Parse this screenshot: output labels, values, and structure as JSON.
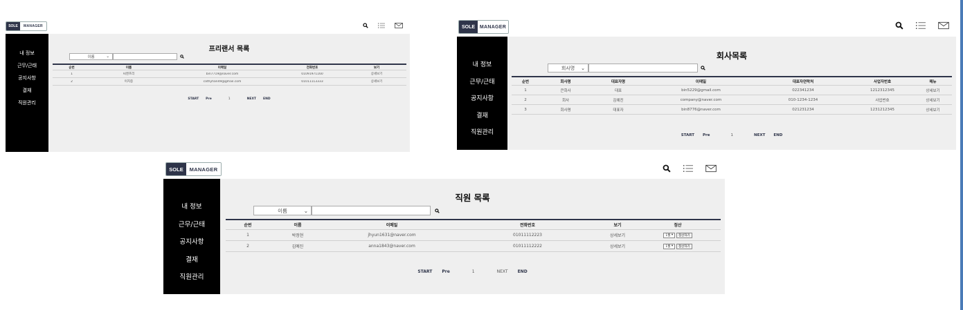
{
  "app": {
    "logo_left": "SOLE",
    "logo_right": "MANAGER"
  },
  "sidebar": {
    "items": [
      "내 정보",
      "근무/근태",
      "공지사항",
      "결재",
      "직원관리"
    ]
  },
  "icons": [
    "search-icon",
    "menu-list-icon",
    "mail-icon"
  ],
  "pager": {
    "start": "START",
    "pre": "Pre",
    "page": "1",
    "next": "NEXT",
    "end": "END"
  },
  "freelancer": {
    "title": "프리랜서 목록",
    "select_value": "이름",
    "search_value": "",
    "columns": [
      "순번",
      "이름",
      "이메일",
      "전화번호",
      "보기"
    ],
    "rows": [
      [
        "1",
        "씨엔프리",
        "bin7719@naver.com",
        "01091971160",
        "상세보기"
      ],
      [
        "2",
        "이지중",
        "cathyhan49@gmail.com",
        "01011113333",
        "상세보기"
      ]
    ]
  },
  "company": {
    "title": "회사목록",
    "select_value": "회사명",
    "search_value": "",
    "columns": [
      "순번",
      "회사명",
      "대표자명",
      "이메일",
      "대표자연락처",
      "사업자번호",
      "메뉴"
    ],
    "rows": [
      [
        "1",
        "큰회사",
        "대표",
        "bin5229@gmail.com",
        "022341234",
        "1212312345",
        "상세보기"
      ],
      [
        "2",
        "회사",
        "김예진",
        "company@naver.com",
        "010-1234-1234",
        "사업번호",
        "상세보기"
      ],
      [
        "3",
        "회사명",
        "대표자",
        "bin8776@naver.com",
        "021231234",
        "1231212345",
        "상세보기"
      ]
    ]
  },
  "employee": {
    "title": "직원 목록",
    "select_value": "이름",
    "search_value": "",
    "columns": [
      "순번",
      "이름",
      "이메일",
      "전화번호",
      "보기",
      "정산"
    ],
    "rows": [
      [
        "1",
        "박정현",
        "jhyun1631@naver.com",
        "01011112223",
        "상세보기"
      ],
      [
        "2",
        "김예진",
        "anna1843@naver.com",
        "01011112222",
        "상세보기"
      ]
    ],
    "settle_month": "1월",
    "settle_button": "정산하기"
  }
}
